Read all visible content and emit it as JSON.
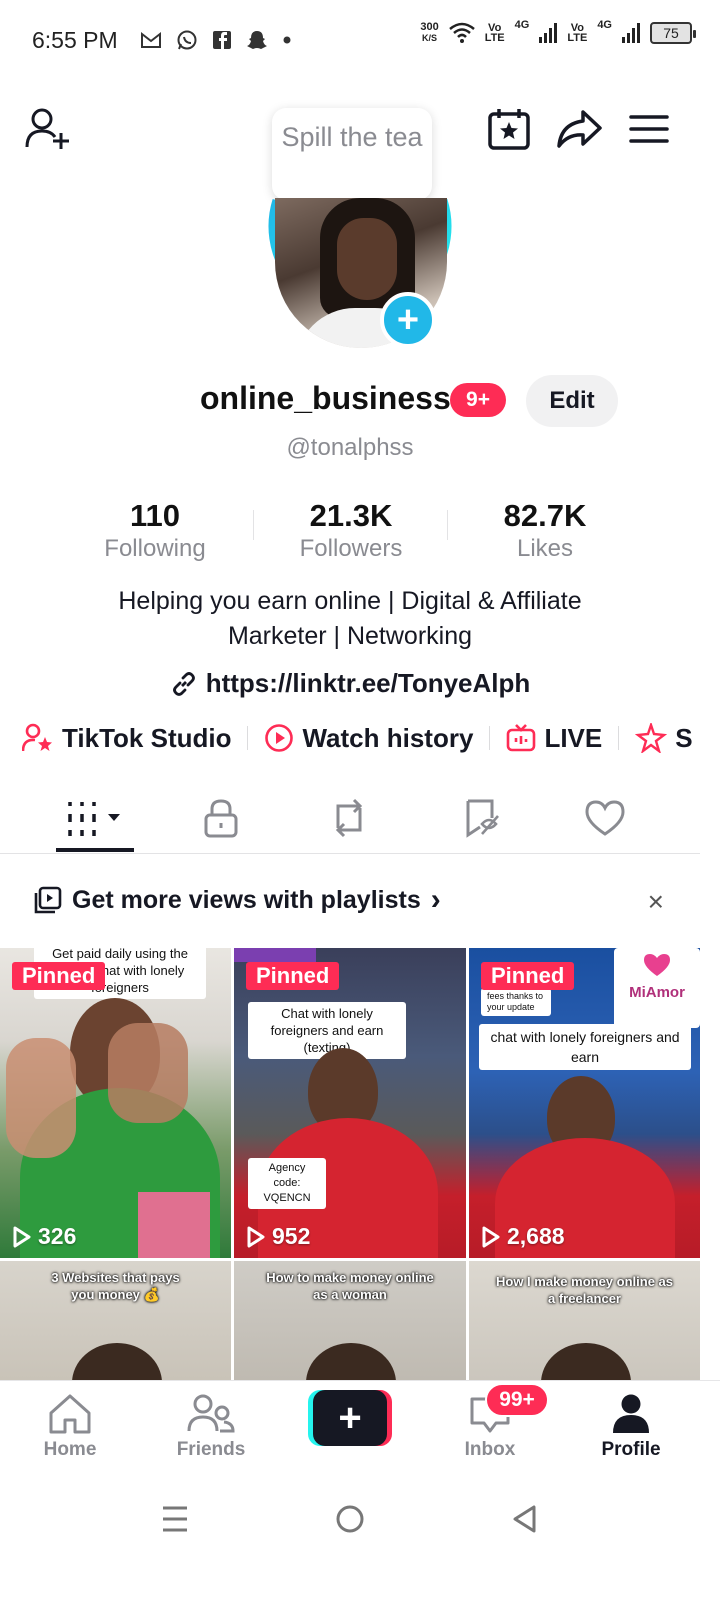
{
  "status_bar": {
    "time": "6:55 PM",
    "notification_icons": [
      "gmail-icon",
      "whatsapp-icon",
      "facebook-icon",
      "snapchat-icon",
      "dot-icon"
    ],
    "net_speed_value": "300",
    "net_speed_unit": "K/S",
    "sim1_vo": "Vo",
    "sim1_lte": "LTE",
    "sim1_net": "4G",
    "sim2_vo": "Vo",
    "sim2_lte": "LTE",
    "sim2_net": "4G",
    "battery": "75"
  },
  "tooltip": {
    "text": "Spill the tea"
  },
  "profile": {
    "display_name": "online_business",
    "name_badge": "9+",
    "edit_label": "Edit",
    "handle": "@tonalphss",
    "stats": [
      {
        "value": "110",
        "label": "Following"
      },
      {
        "value": "21.3K",
        "label": "Followers"
      },
      {
        "value": "82.7K",
        "label": "Likes"
      }
    ],
    "bio_line1": "Helping you earn online | Digital & Affiliate",
    "bio_line2": "Marketer | Networking",
    "link": "https://linktr.ee/TonyeAlph"
  },
  "shortcuts": [
    {
      "label": "TikTok Studio",
      "icon": "person-star-icon"
    },
    {
      "label": "Watch history",
      "icon": "play-circle-icon"
    },
    {
      "label": "LIVE",
      "icon": "tv-icon"
    },
    {
      "label": "S",
      "icon": "sparkle-icon"
    }
  ],
  "content_tabs": [
    "videos-grid-icon",
    "lock-icon",
    "repost-icon",
    "saved-icon",
    "heart-icon"
  ],
  "banner": {
    "text": "Get more views with playlists",
    "chevron": "›",
    "close": "×"
  },
  "videos": [
    {
      "pinned": "Pinned",
      "views": "326",
      "caption": "Get paid daily using the app to chat with lonely foreigners"
    },
    {
      "pinned": "Pinned",
      "views": "952",
      "caption": "Chat with lonely foreigners and earn (texting)",
      "code_label": "Agency code:",
      "code": "VQENCN"
    },
    {
      "pinned": "Pinned",
      "views": "2,688",
      "caption": "chat with lonely foreigners and earn",
      "sub_caption": "fees thanks to your update",
      "brand": "MiAmor"
    },
    {
      "caption": "3 Websites that pays you money 💰"
    },
    {
      "caption": "How to make money online as a woman"
    },
    {
      "caption": "How I make money online as a freelancer"
    }
  ],
  "pinned_label": "Pinned",
  "bottom_nav": {
    "home": "Home",
    "friends": "Friends",
    "create": "+",
    "inbox": "Inbox",
    "inbox_badge": "99+",
    "profile": "Profile"
  },
  "colors": {
    "accent": "#fe2c55",
    "cyan": "#25f4ee",
    "avatar_ring": "#21b8e8",
    "text_primary": "#161823",
    "text_secondary": "#8a8b91"
  }
}
